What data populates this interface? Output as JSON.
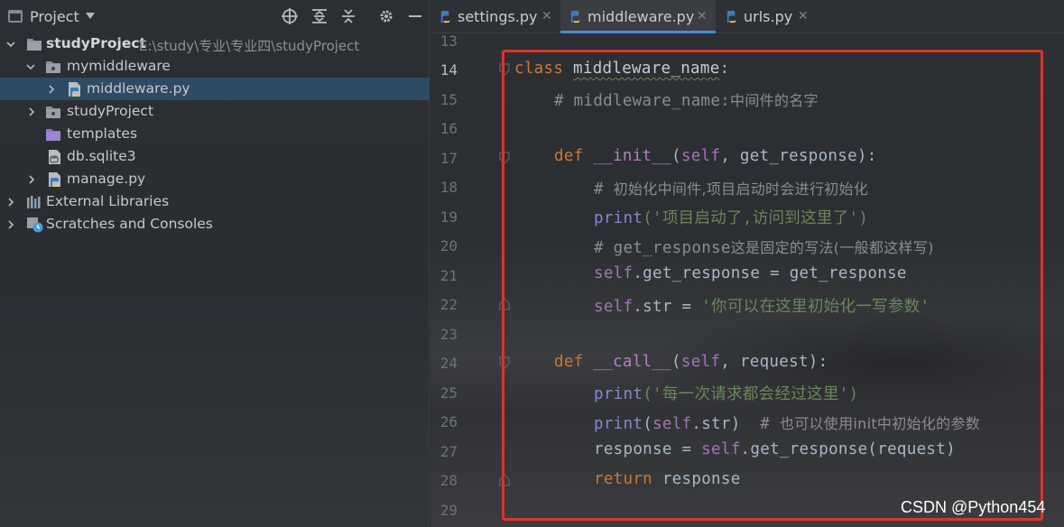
{
  "project_panel": {
    "title": "Project",
    "toolbar_icons": [
      "locate-icon",
      "expand-all-icon",
      "collapse-all-icon",
      "gear-icon",
      "minimize-icon"
    ],
    "tree": [
      {
        "label": "studyProject",
        "path": "E:\\study\\专业\\专业四\\studyProject",
        "icon": "folder-icon",
        "expanded": true
      },
      {
        "label": "mymiddleware",
        "icon": "package-folder-icon",
        "expanded": true
      },
      {
        "label": "middleware.py",
        "icon": "python-file-icon",
        "selected": true
      },
      {
        "label": "studyProject",
        "icon": "package-folder-icon"
      },
      {
        "label": "templates",
        "icon": "templates-folder-icon"
      },
      {
        "label": "db.sqlite3",
        "icon": "database-file-icon"
      },
      {
        "label": "manage.py",
        "icon": "python-file-icon"
      },
      {
        "label": "External Libraries",
        "icon": "libraries-icon"
      },
      {
        "label": "Scratches and Consoles",
        "icon": "scratches-icon"
      }
    ]
  },
  "tabs": [
    {
      "label": "settings.py",
      "active": false
    },
    {
      "label": "middleware.py",
      "active": true
    },
    {
      "label": "urls.py",
      "active": false
    }
  ],
  "editor": {
    "current_line": "14",
    "line_numbers": [
      "13",
      "14",
      "15",
      "16",
      "17",
      "18",
      "19",
      "20",
      "21",
      "22",
      "23",
      "24",
      "25",
      "26",
      "27",
      "28",
      "29"
    ],
    "code": {
      "l14_kw": "class",
      "l14_name": "middleware_name",
      "l14_colon": ":",
      "l15": "# middleware_name:",
      "l15_cn": "中间件的名字",
      "l17_kw": "def",
      "l17_fn": "__init__",
      "l17_open": "(",
      "l17_self": "self",
      "l17_rest": ", get_response):",
      "l18": "# ",
      "l18_cn": "初始化中间件,项目启动时会进行初始化",
      "l19_fn": "print",
      "l19_str": "('项目启动了,访问到这里了')",
      "l20": "# get_response",
      "l20_cn": "这是固定的写法(一般都这样写)",
      "l21_self": "self",
      "l21_rest": ".get_response = get_response",
      "l22_self": "self",
      "l22_rest": ".str = ",
      "l22_str": "'你可以在这里初始化一写参数'",
      "l24_kw": "def",
      "l24_fn": "__call__",
      "l24_open": "(",
      "l24_self": "self",
      "l24_rest": ", request):",
      "l25_fn": "print",
      "l25_str": "('每一次请求都会经过这里')",
      "l26_fn": "print",
      "l26_open": "(",
      "l26_self": "self",
      "l26_rest": ".str)  ",
      "l26_cm": "# ",
      "l26_cn": "也可以使用init中初始化的参数",
      "l27_pre": "response = ",
      "l27_self": "self",
      "l27_rest": ".get_response(request)",
      "l28_kw": "return",
      "l28_rest": " response"
    }
  },
  "watermark": "CSDN @Python454",
  "colors": {
    "highlight_box": "#e0312a",
    "keyword": "#cc7832",
    "string": "#6a8759",
    "self": "#a672b8",
    "comment": "#8b8c8e",
    "selection": "#2f4a63",
    "tab_accent": "#4b8bd6"
  }
}
